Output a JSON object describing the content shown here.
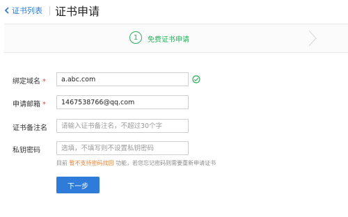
{
  "header": {
    "back_label": "证书列表",
    "title": "证书申请"
  },
  "stepbar": {
    "step_number": "1",
    "step_label": "免费证书申请"
  },
  "form": {
    "domain": {
      "label": "绑定域名",
      "required_mark": "*",
      "value": "a.abc.com"
    },
    "email": {
      "label": "申请邮箱",
      "required_mark": "*",
      "value": "1467538766@qq.com"
    },
    "remark": {
      "label": "证书备注名",
      "placeholder": "请输入证书备注名，不超过30个字"
    },
    "password": {
      "label": "私钥密码",
      "placeholder": "选填，不填写则不设置私钥密码"
    },
    "hint": {
      "prefix": "目前",
      "warning": "暂不支持密码找回",
      "suffix": "功能，若您忘记密码则需要重新申请证书"
    },
    "next_label": "下一步"
  },
  "colors": {
    "accent": "#2f7bd9",
    "success": "#2fae5e",
    "required": "#e0463b",
    "warning": "#e8823a"
  }
}
